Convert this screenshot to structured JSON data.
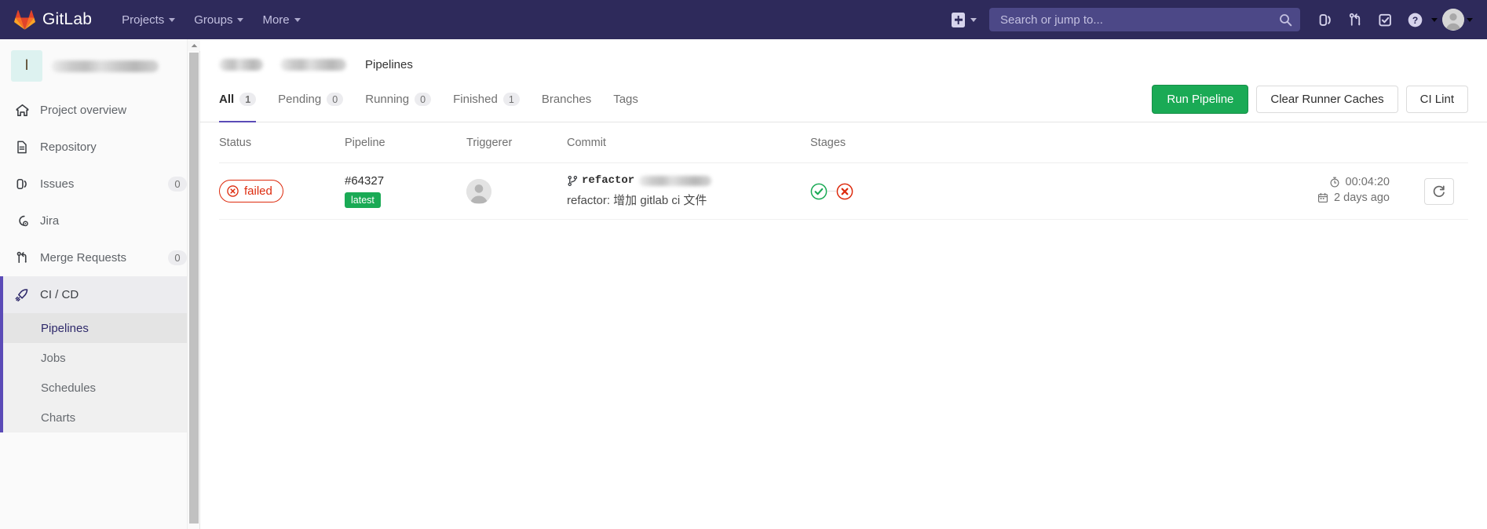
{
  "navbar": {
    "brand": "GitLab",
    "links": [
      {
        "label": "Projects",
        "name": "projects"
      },
      {
        "label": "Groups",
        "name": "groups"
      },
      {
        "label": "More",
        "name": "more"
      }
    ],
    "search_placeholder": "Search or jump to...",
    "icons": {
      "plus": "plus-square-icon",
      "issues": "issues-icon",
      "merge_requests": "merge-request-icon",
      "todos": "todo-checkbox-icon",
      "help": "help-question-icon",
      "avatar": "user-avatar-icon"
    }
  },
  "sidebar": {
    "project_initial": "I",
    "project_name_redacted": true,
    "items": [
      {
        "label": "Project overview",
        "icon": "home-icon",
        "badge": ""
      },
      {
        "label": "Repository",
        "icon": "document-icon",
        "badge": ""
      },
      {
        "label": "Issues",
        "icon": "issues-icon",
        "badge": "0"
      },
      {
        "label": "Jira",
        "icon": "jira-gear-icon",
        "badge": ""
      },
      {
        "label": "Merge Requests",
        "icon": "merge-request-icon",
        "badge": "0"
      },
      {
        "label": "CI / CD",
        "icon": "rocket-icon",
        "badge": ""
      }
    ],
    "subitems": [
      {
        "label": "Pipelines",
        "current": true
      },
      {
        "label": "Jobs",
        "current": false
      },
      {
        "label": "Schedules",
        "current": false
      },
      {
        "label": "Charts",
        "current": false
      }
    ]
  },
  "breadcrumb": {
    "current": "Pipelines"
  },
  "tabs": [
    {
      "label": "All",
      "count": "1",
      "active": true
    },
    {
      "label": "Pending",
      "count": "0",
      "active": false
    },
    {
      "label": "Running",
      "count": "0",
      "active": false
    },
    {
      "label": "Finished",
      "count": "1",
      "active": false
    },
    {
      "label": "Branches",
      "count": "",
      "active": false
    },
    {
      "label": "Tags",
      "count": "",
      "active": false
    }
  ],
  "actions": {
    "run_pipeline": "Run Pipeline",
    "clear_runner_caches": "Clear Runner Caches",
    "ci_lint": "CI Lint"
  },
  "table": {
    "headers": {
      "status": "Status",
      "pipeline": "Pipeline",
      "triggerer": "Triggerer",
      "commit": "Commit",
      "stages": "Stages"
    },
    "rows": [
      {
        "status": "failed",
        "status_icon": "failed-x-circle-icon",
        "pipeline_id": "#64327",
        "latest_badge": "latest",
        "triggerer_avatar": "user-avatar-icon",
        "branch": "refactor",
        "branch_icon": "branch-icon",
        "commit_sha_redacted": true,
        "commit_message": "refactor: 增加 gitlab ci 文件",
        "stages": [
          {
            "state": "passed",
            "icon": "check-circle-icon"
          },
          {
            "state": "failed",
            "icon": "x-circle-icon"
          }
        ],
        "duration": "00:04:20",
        "duration_icon": "timer-icon",
        "finished": "2 days ago",
        "finished_icon": "calendar-icon",
        "retry_label": "retry-icon"
      }
    ]
  },
  "colors": {
    "navbar": "#2e2a5b",
    "primary_green": "#1aaa55",
    "failed_red": "#dd2b0e",
    "accent_purple": "#5b4bb7"
  }
}
